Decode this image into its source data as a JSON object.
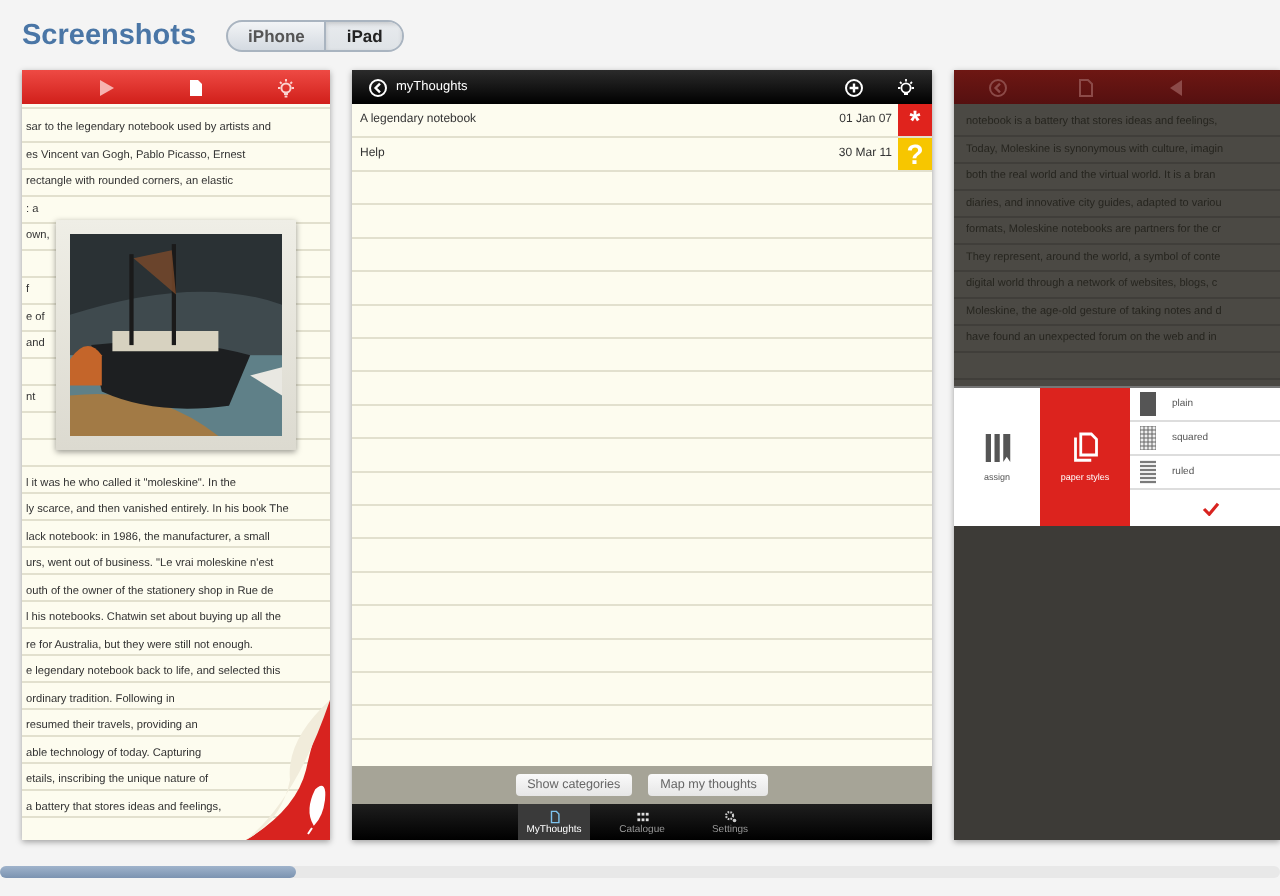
{
  "header": {
    "title": "Screenshots",
    "device_tabs": [
      {
        "label": "iPhone",
        "selected": false
      },
      {
        "label": "iPad",
        "selected": true
      }
    ]
  },
  "note_screen": {
    "upper_blocks": [
      [
        "sar to the legendary notebook used by artists and",
        "es Vincent van Gogh, Pablo Picasso, Ernest",
        "rectangle with rounded corners, an elastic",
        ": a",
        "own,"
      ],
      [
        "f",
        "e of",
        "and"
      ],
      [
        "nt"
      ]
    ],
    "lower_lines": [
      "l it was he who called it \"moleskine\". In the",
      "ly scarce, and then vanished entirely. In his book The",
      "lack notebook: in 1986, the manufacturer, a small",
      "urs, went out of business. \"Le vrai moleskine n'est",
      "outh of the owner of the stationery shop in Rue de",
      "l his notebooks. Chatwin set about buying up all the",
      "re for Australia, but they were still not enough.",
      "e legendary notebook back to life, and selected this",
      "ordinary tradition. Following in",
      "resumed their travels, providing an",
      "able technology of today. Capturing",
      "etails, inscribing the unique nature of",
      " a battery that stores ideas and feelings,"
    ]
  },
  "list_screen": {
    "title": "myThoughts",
    "notes": [
      {
        "title": "A legendary notebook",
        "date": "01 Jan 07",
        "tile": "*",
        "color": "#e0231d"
      },
      {
        "title": "Help",
        "date": "30 Mar 11",
        "tile": "?",
        "color": "#f7c600"
      }
    ],
    "buttons": [
      "Show categories",
      "Map my thoughts"
    ],
    "tabs": [
      {
        "label": "MyThoughts",
        "kind": "document",
        "selected": true
      },
      {
        "label": "Catalogue",
        "kind": "catalogue",
        "selected": false
      },
      {
        "label": "Settings",
        "kind": "settings",
        "selected": false
      }
    ]
  },
  "style_screen": {
    "lines": [
      "notebook is a battery that stores ideas and feelings,",
      "Today, Moleskine is synonymous with culture, imagin",
      "both the real world and the virtual world. It is a bran",
      "diaries, and innovative city guides, adapted to variou",
      "formats, Moleskine notebooks are partners for the cr",
      "They represent, around the world, a symbol of conte",
      "digital world through a network of websites, blogs, c",
      "Moleskine, the age-old gesture of taking notes and d",
      "have found an unexpected forum on the web and in"
    ],
    "modes": [
      {
        "label": "assign",
        "kind": "assign",
        "selected": false
      },
      {
        "label": "paper styles",
        "kind": "styles",
        "selected": true
      }
    ],
    "paper_styles": [
      {
        "label": "plain",
        "kind": "plain"
      },
      {
        "label": "squared",
        "kind": "squared"
      },
      {
        "label": "ruled",
        "kind": "ruled"
      }
    ]
  }
}
